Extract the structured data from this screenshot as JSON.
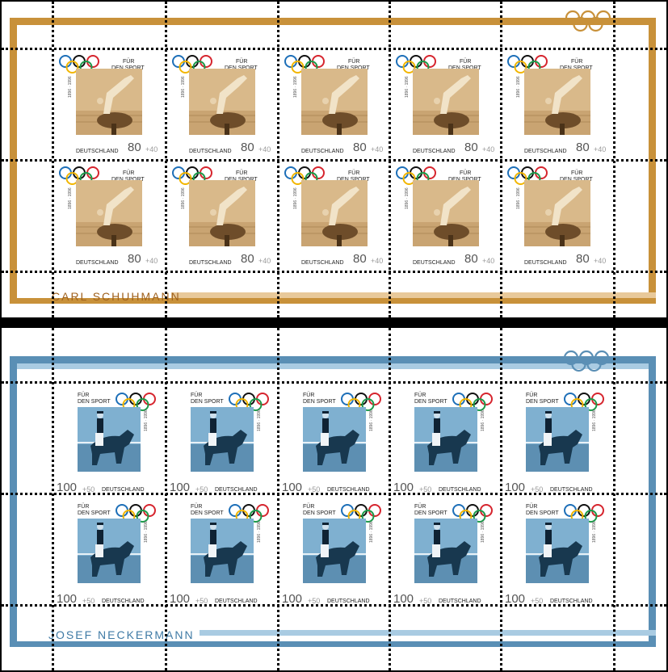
{
  "sheets": [
    {
      "id": "top",
      "title": "CARL SCHUHMANN",
      "accent": "#c8913a",
      "frame_light": "#e8c99a",
      "stamp": {
        "value": "80",
        "surcharge": "+40",
        "country": "DEUTSCHLAND",
        "line1": "FÜR",
        "line2": "DEN SPORT",
        "years": "1896 · 1996",
        "name": "Carl Schuhmann"
      }
    },
    {
      "id": "bottom",
      "title": "JOSEF NECKERMANN",
      "accent": "#5a8fb5",
      "frame_light": "#a9cbe2",
      "stamp": {
        "value": "100",
        "surcharge": "+50",
        "country": "DEUTSCHLAND",
        "line1": "FÜR",
        "line2": "DEN SPORT",
        "years": "1896 · 1996",
        "name": "Josef Neckermann"
      }
    }
  ],
  "colors": {
    "ring_blue": "#1d6fb8",
    "ring_yellow": "#f2b600",
    "ring_black": "#111111",
    "ring_green": "#1c9a4a",
    "ring_red": "#d6252e",
    "sepia_light": "#d9b98a",
    "sepia_dark": "#6e4d2a",
    "blue_sky": "#7fb0d0",
    "blue_dark": "#18384f"
  },
  "icons": [
    "olympic-rings-icon",
    "gymnast-photo",
    "dressage-rider-photo"
  ]
}
